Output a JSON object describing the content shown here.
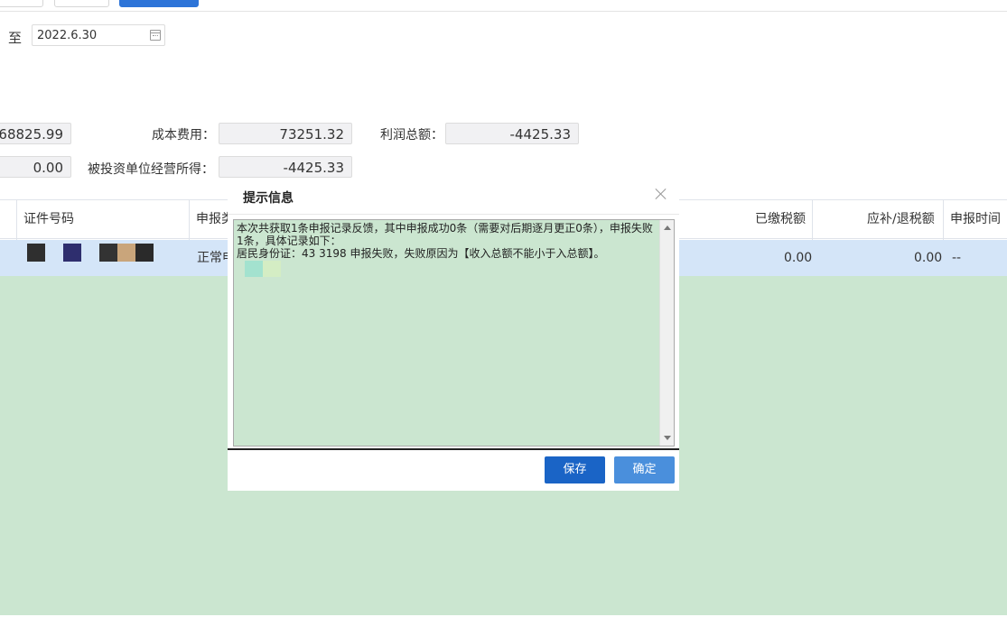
{
  "date_range": {
    "to_label": "至",
    "end_date": "2022.6.30"
  },
  "summary": {
    "income_value": "68825.99",
    "cost_label": "成本费用：",
    "cost_value": "73251.32",
    "profit_label": "利润总额：",
    "profit_value": "-4425.33",
    "second_value": "0.00",
    "invested_income_label": "被投资单位经营所得：",
    "invested_income_value": "-4425.33"
  },
  "table": {
    "headers": [
      "证件号码",
      "申报类",
      "已缴税额",
      "应补/退税额",
      "申报时间"
    ],
    "row": {
      "declare_type": "正常申",
      "paid_tax": "0.00",
      "refund_tax": "0.00",
      "declare_time": "--"
    }
  },
  "dialog": {
    "title": "提示信息",
    "message": "本次共获取1条申报记录反馈，其中申报成功0条（需要对后期逐月更正0条），申报失败1条，具体记录如下：\n居民身份证：43 3198 申报失败，失败原因为【收入总额不能小于入总额】。",
    "save_label": "保存",
    "ok_label": "确定"
  },
  "colors": {
    "accent": "#1a64c6",
    "row_selected": "#d4e5f8",
    "overlay_green": "#cbe6d0"
  },
  "icons": [
    "calendar-icon",
    "close-icon",
    "scroll-up-icon",
    "scroll-down-icon"
  ]
}
